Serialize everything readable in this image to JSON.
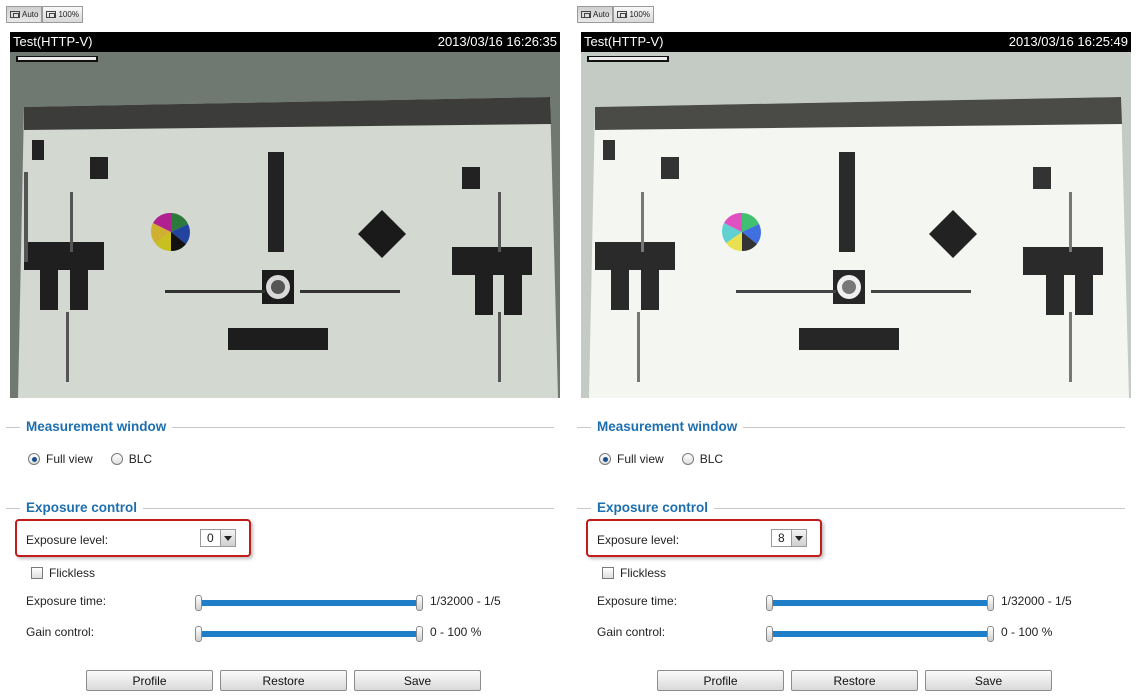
{
  "zoom": {
    "auto_label": "Auto",
    "full_label": "100%"
  },
  "panels": [
    {
      "stream_name": "Test(HTTP-V)",
      "timestamp": "2013/03/16 16:26:35",
      "measurement_title": "Measurement window",
      "radio_full": "Full view",
      "radio_blc": "BLC",
      "exposure_title": "Exposure control",
      "exposure_label": "Exposure level:",
      "exposure_value": "0",
      "flickless_label": "Flickless",
      "exposure_time_label": "Exposure time:",
      "exposure_time_value": "1/32000 - 1/5",
      "gain_label": "Gain control:",
      "gain_value": "0 - 100 %"
    },
    {
      "stream_name": "Test(HTTP-V)",
      "timestamp": "2013/03/16 16:25:49",
      "measurement_title": "Measurement window",
      "radio_full": "Full view",
      "radio_blc": "BLC",
      "exposure_title": "Exposure control",
      "exposure_label": "Exposure level:",
      "exposure_value": "8",
      "flickless_label": "Flickless",
      "exposure_time_label": "Exposure time:",
      "exposure_time_value": "1/32000 - 1/5",
      "gain_label": "Gain control:",
      "gain_value": "0 - 100 %"
    }
  ],
  "buttons": {
    "profile": "Profile",
    "restore": "Restore",
    "save": "Save"
  },
  "colors": {
    "accent": "#1d6fae",
    "highlight": "#c21b1b",
    "slider": "#1e7fc8"
  }
}
